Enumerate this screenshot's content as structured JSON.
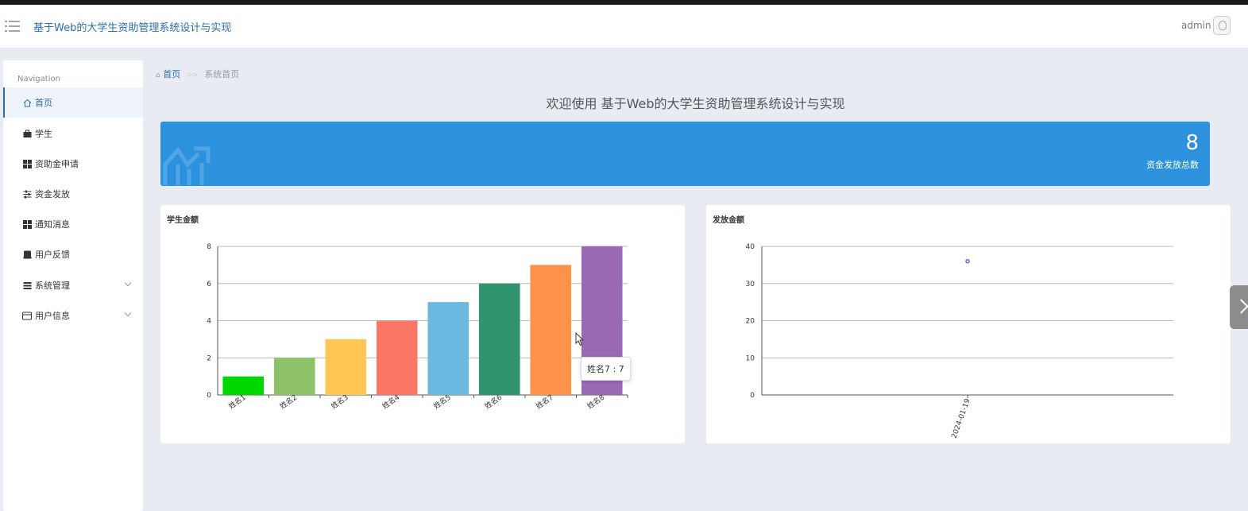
{
  "header": {
    "title": "基于Web的大学生资助管理系统设计与实现",
    "user": "admin"
  },
  "sidebar": {
    "heading": "Navigation",
    "items": [
      {
        "label": "首页",
        "icon": "home-icon",
        "active": true
      },
      {
        "label": "学生",
        "icon": "briefcase-icon"
      },
      {
        "label": "资助金申请",
        "icon": "grid-icon"
      },
      {
        "label": "资金发放",
        "icon": "sliders-icon"
      },
      {
        "label": "通知消息",
        "icon": "grid-icon"
      },
      {
        "label": "用户反馈",
        "icon": "inbox-icon"
      },
      {
        "label": "系统管理",
        "icon": "list-icon",
        "expandable": true
      },
      {
        "label": "用户信息",
        "icon": "card-icon",
        "expandable": true
      }
    ]
  },
  "breadcrumb": {
    "home": "首页",
    "separator": ">>",
    "current": "系统首页"
  },
  "welcome": "欢迎使用 基于Web的大学生资助管理系统设计与实现",
  "banner": {
    "value": "8",
    "label": "资金发放总数",
    "color": "#2d92de"
  },
  "chart_tooltip": "姓名7 : 7",
  "chart_data": [
    {
      "type": "bar",
      "title": "学生金额",
      "categories": [
        "姓名1",
        "姓名2",
        "姓名3",
        "姓名4",
        "姓名5",
        "姓名6",
        "姓名7",
        "姓名8"
      ],
      "values": [
        1,
        2,
        3,
        4,
        5,
        6,
        7,
        8
      ],
      "colors": [
        "#00d700",
        "#8fc36a",
        "#ffc653",
        "#fc7666",
        "#6bb8e0",
        "#30956e",
        "#ff914a",
        "#9a69b5"
      ],
      "ylim": [
        0,
        8
      ],
      "yticks": [
        0,
        2,
        4,
        6,
        8
      ],
      "grid": true
    },
    {
      "type": "scatter",
      "title": "发放金额",
      "categories": [
        "2024-01-19"
      ],
      "values": [
        36
      ],
      "ylim": [
        0,
        40
      ],
      "yticks": [
        0,
        10,
        20,
        30,
        40
      ],
      "grid": true,
      "color": "#5470c6"
    }
  ]
}
